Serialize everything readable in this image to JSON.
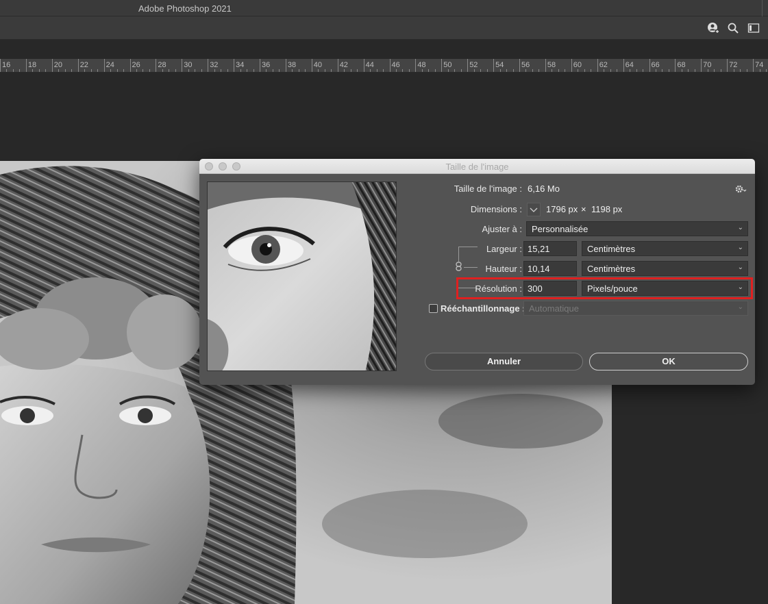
{
  "app": {
    "title": "Adobe Photoshop 2021"
  },
  "ruler": {
    "labels": [
      "16",
      "18",
      "20",
      "22",
      "24",
      "26",
      "28",
      "30",
      "32",
      "34",
      "36",
      "38",
      "40",
      "42",
      "44",
      "46",
      "48",
      "50",
      "52",
      "54",
      "56",
      "58",
      "60",
      "62",
      "64",
      "66",
      "68",
      "70",
      "72",
      "74"
    ]
  },
  "dialog": {
    "title": "Taille de l'image",
    "image_size_label": "Taille de l'image :",
    "image_size_value": "6,16 Mo",
    "dimensions_label": "Dimensions :",
    "dimensions_w": "1796 px",
    "dimensions_x": "×",
    "dimensions_h": "1198 px",
    "fit_label": "Ajuster à :",
    "fit_value": "Personnalisée",
    "width_label": "Largeur :",
    "width_value": "15,21",
    "width_unit": "Centimètres",
    "height_label": "Hauteur :",
    "height_value": "10,14",
    "height_unit": "Centimètres",
    "resolution_label": "Résolution :",
    "resolution_value": "300",
    "resolution_unit": "Pixels/pouce",
    "resample_label": "Rééchantillonnage :",
    "resample_checked": false,
    "resample_value": "Automatique",
    "cancel_label": "Annuler",
    "ok_label": "OK"
  },
  "icons": {
    "options": [
      "user-add-icon",
      "search-icon",
      "workspace-icon"
    ],
    "settings": "gear-icon",
    "chain": "link-icon",
    "dimensions_toggle": "chevron-down-icon"
  },
  "colors": {
    "highlight": "#e02020",
    "dialog_bg": "#535353",
    "canvas_bg": "#282828"
  }
}
